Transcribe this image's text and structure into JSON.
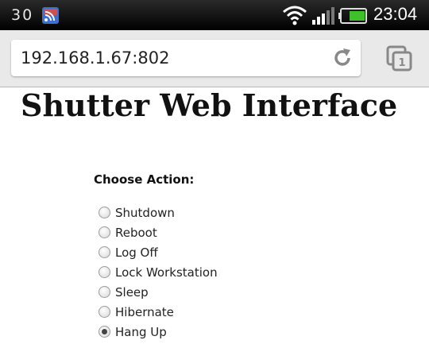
{
  "status_bar": {
    "left_text": "30",
    "time": "23:04",
    "icons": [
      "rss-icon",
      "wifi-icon",
      "signal-icon",
      "battery-icon"
    ],
    "battery_color": "#3fbf2a"
  },
  "browser": {
    "url": "192.168.1.67:802",
    "refresh_icon": "refresh-icon",
    "tabs_icon": "tabs-icon",
    "tab_count": "1"
  },
  "page": {
    "title": "Shutter Web Interface",
    "choose_label": "Choose Action:",
    "options": [
      {
        "label": "Shutdown",
        "checked": false
      },
      {
        "label": "Reboot",
        "checked": false
      },
      {
        "label": "Log Off",
        "checked": false
      },
      {
        "label": "Lock Workstation",
        "checked": false
      },
      {
        "label": "Sleep",
        "checked": false
      },
      {
        "label": "Hibernate",
        "checked": false
      },
      {
        "label": "Hang Up",
        "checked": true
      }
    ]
  }
}
